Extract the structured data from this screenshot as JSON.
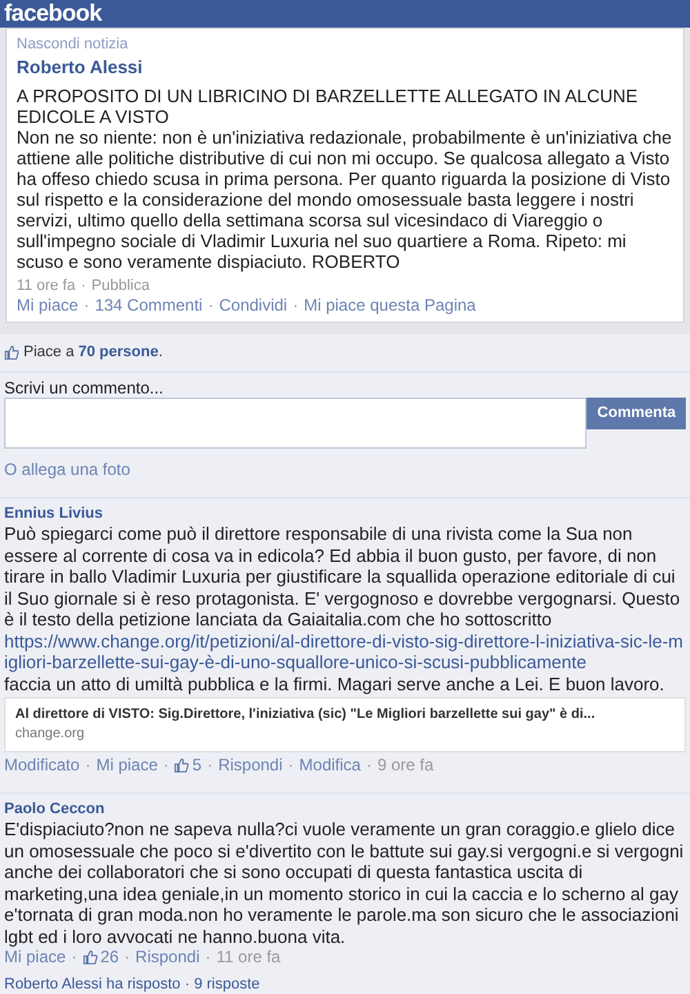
{
  "header": {
    "logo": "facebook"
  },
  "separator": "·",
  "post": {
    "hide_link": "Nascondi notizia",
    "author": "Roberto Alessi",
    "title": "A PROPOSITO DI UN LIBRICINO DI BARZELLETTE ALLEGATO IN ALCUNE EDICOLE A VISTO",
    "body": "Non ne so niente: non è un'iniziativa redazionale, probabilmente è un'iniziativa che attiene alle politiche distributive di cui non mi occupo. Se qualcosa allegato a Visto ha offeso chiedo scusa in prima persona. Per quanto riguarda la posizione di Visto sul rispetto e la considerazione del mondo omosessuale basta leggere i nostri servizi, ultimo quello della settimana scorsa sul vicesindaco di Viareggio o sull'impegno sociale di Vladimir Luxuria nel suo quartiere a Roma. Ripeto: mi scuso e sono veramente dispiaciuto. ROBERTO",
    "meta": [
      "11 ore fa",
      "Pubblica"
    ],
    "actions": [
      "Mi piace",
      "134 Commenti",
      "Condividi",
      "Mi piace questa Pagina"
    ]
  },
  "likes": {
    "prefix": "Piace a",
    "link": "70 persone",
    "suffix": "."
  },
  "comment_box": {
    "label": "Scrivi un commento...",
    "button": "Commenta",
    "attach": "O allega una foto"
  },
  "comments": [
    {
      "author": "Ennius Livius",
      "parts": [
        {
          "kind": "text",
          "text": "Può spiegarci come può il direttore responsabile di una rivista come la Sua non essere al corrente di cosa va in edicola? Ed abbia il buon gusto, per favore, di non tirare in ballo Vladimir Luxuria per giustificare la squallida operazione editoriale di cui il Suo giornale si è reso protagonista. E' vergognoso e dovrebbe vergognarsi. Questo è il testo della petizione lanciata da Gaiaitalia.com che ho sottoscritto "
        },
        {
          "kind": "link",
          "text": "https://www.change.org/it/petizioni/al-direttore-di-visto-sig-direttore-l-iniziativa-sic-le-migliori-barzellette-sui-gay-è-di-uno-squallore-unico-si-scusi-pubblicamente"
        },
        {
          "kind": "text",
          "text": " faccia un atto di umiltà pubblica e la firmi. Magari serve anche a Lei. E buon lavoro."
        }
      ],
      "preview": {
        "title": "Al direttore di VISTO: Sig.Direttore, l'iniziativa (sic) \"Le Migliori barzellette sui gay\" è di...",
        "domain": "change.org"
      },
      "actions": [
        {
          "kind": "link",
          "text": "Modificato"
        },
        {
          "kind": "link",
          "text": "Mi piace"
        },
        {
          "kind": "likes",
          "text": "5"
        },
        {
          "kind": "link",
          "text": "Rispondi"
        },
        {
          "kind": "link",
          "text": "Modifica"
        },
        {
          "kind": "time",
          "text": "9 ore fa"
        }
      ]
    },
    {
      "author": "Paolo Ceccon",
      "parts": [
        {
          "kind": "text",
          "text": "E'dispiaciuto?non ne sapeva nulla?ci vuole veramente un gran coraggio.e glielo dice un omosessuale che poco si e'divertito con le battute sui gay.si vergogni.e si vergogni anche dei collaboratori che si sono occupati di questa fantastica uscita di marketing,una idea geniale,in un momento storico in cui la caccia e lo scherno al gay e'tornata di gran moda.non ho veramente le parole.ma son sicuro che le associazioni lgbt ed i loro avvocati ne hanno.buona vita."
        }
      ],
      "actions": [
        {
          "kind": "link",
          "text": "Mi piace"
        },
        {
          "kind": "likes",
          "text": "26"
        },
        {
          "kind": "link",
          "text": "Rispondi"
        },
        {
          "kind": "time",
          "text": "11 ore fa"
        }
      ],
      "replies": "Roberto Alessi ha risposto · 9 risposte"
    }
  ]
}
